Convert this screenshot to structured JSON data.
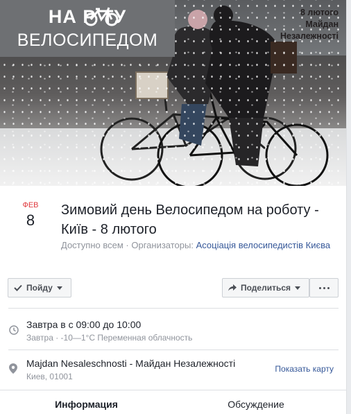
{
  "cover": {
    "badge_line1": "НА Р    ТУ",
    "badge_line2": "ВЕЛОСИПЕДОМ",
    "date_line1": "8 лютого",
    "date_line2": "Майдан",
    "date_line3": "Незалежності"
  },
  "event": {
    "month": "ФЕВ",
    "day": "8",
    "title": "Зимовий день Велосипедом на роботу - Київ - 8 лютого",
    "visibility": "Доступно всем",
    "separator": "·",
    "organizers_label": "Организаторы:",
    "organizer": "Асоціація велосипедистів Києва"
  },
  "actions": {
    "go_label": "Пойду",
    "share_label": "Поделиться"
  },
  "time": {
    "main": "Завтра в с 09:00 до 10:00",
    "sub": "Завтра · -10—1°C Переменная облачность"
  },
  "location": {
    "main": "Majdan Nesaleschnosti - Майдан Незалежності",
    "sub": "Киев, 01001",
    "map_link": "Показать карту"
  },
  "tabs": {
    "info": "Информация",
    "discussion": "Обсуждение"
  },
  "colors": {
    "accent_red": "#e0393e",
    "link_blue": "#365899"
  }
}
